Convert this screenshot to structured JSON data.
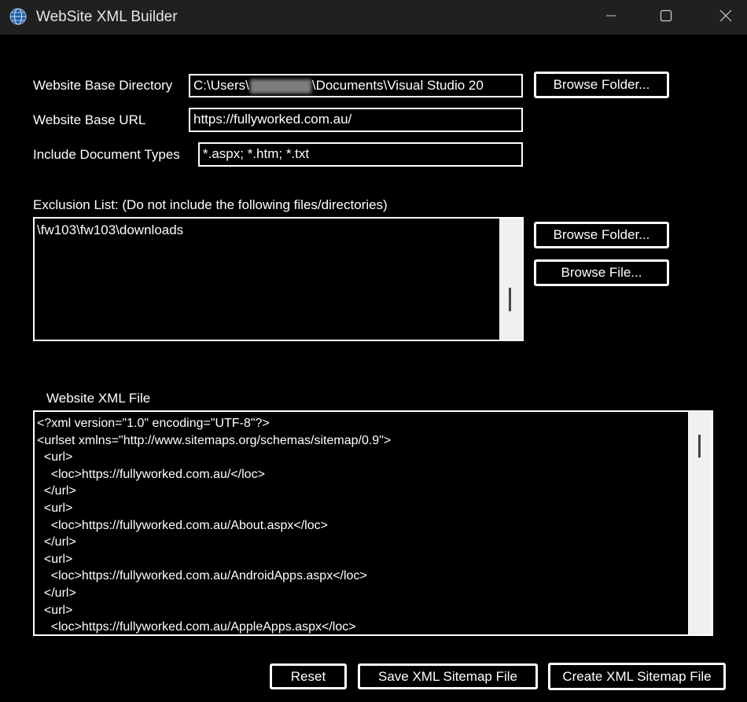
{
  "window": {
    "title": "WebSite XML Builder"
  },
  "icons": {
    "app": "globe-icon",
    "minimize": "minimize-icon",
    "maximize": "maximize-icon",
    "close": "close-icon"
  },
  "form": {
    "base_dir_label": "Website Base Directory",
    "base_dir_prefix": "C:\\Users\\",
    "base_dir_suffix": "\\Documents\\Visual Studio 20",
    "browse_folder_label": "Browse Folder...",
    "base_url_label": "Website Base URL",
    "base_url_value": "https://fullyworked.com.au/",
    "doc_types_label": "Include Document Types",
    "doc_types_value": "*.aspx; *.htm; *.txt"
  },
  "exclusion": {
    "label": "Exclusion List: (Do not include the following files/directories)",
    "value": "\\fw103\\fw103\\downloads",
    "browse_folder_label": "Browse Folder...",
    "browse_file_label": "Browse File..."
  },
  "xml_file": {
    "label": "Website XML File",
    "lines": [
      "<?xml version=\"1.0\" encoding=\"UTF-8\"?>",
      "<urlset xmlns=\"http://www.sitemaps.org/schemas/sitemap/0.9\">",
      "  <url>",
      "    <loc>https://fullyworked.com.au/</loc>",
      "  </url>",
      "  <url>",
      "    <loc>https://fullyworked.com.au/About.aspx</loc>",
      "  </url>",
      "  <url>",
      "    <loc>https://fullyworked.com.au/AndroidApps.aspx</loc>",
      "  </url>",
      "  <url>",
      "    <loc>https://fullyworked.com.au/AppleApps.aspx</loc>"
    ]
  },
  "actions": {
    "reset_label": "Reset",
    "save_label": "Save XML Sitemap File",
    "create_label": "Create XML Sitemap File"
  }
}
